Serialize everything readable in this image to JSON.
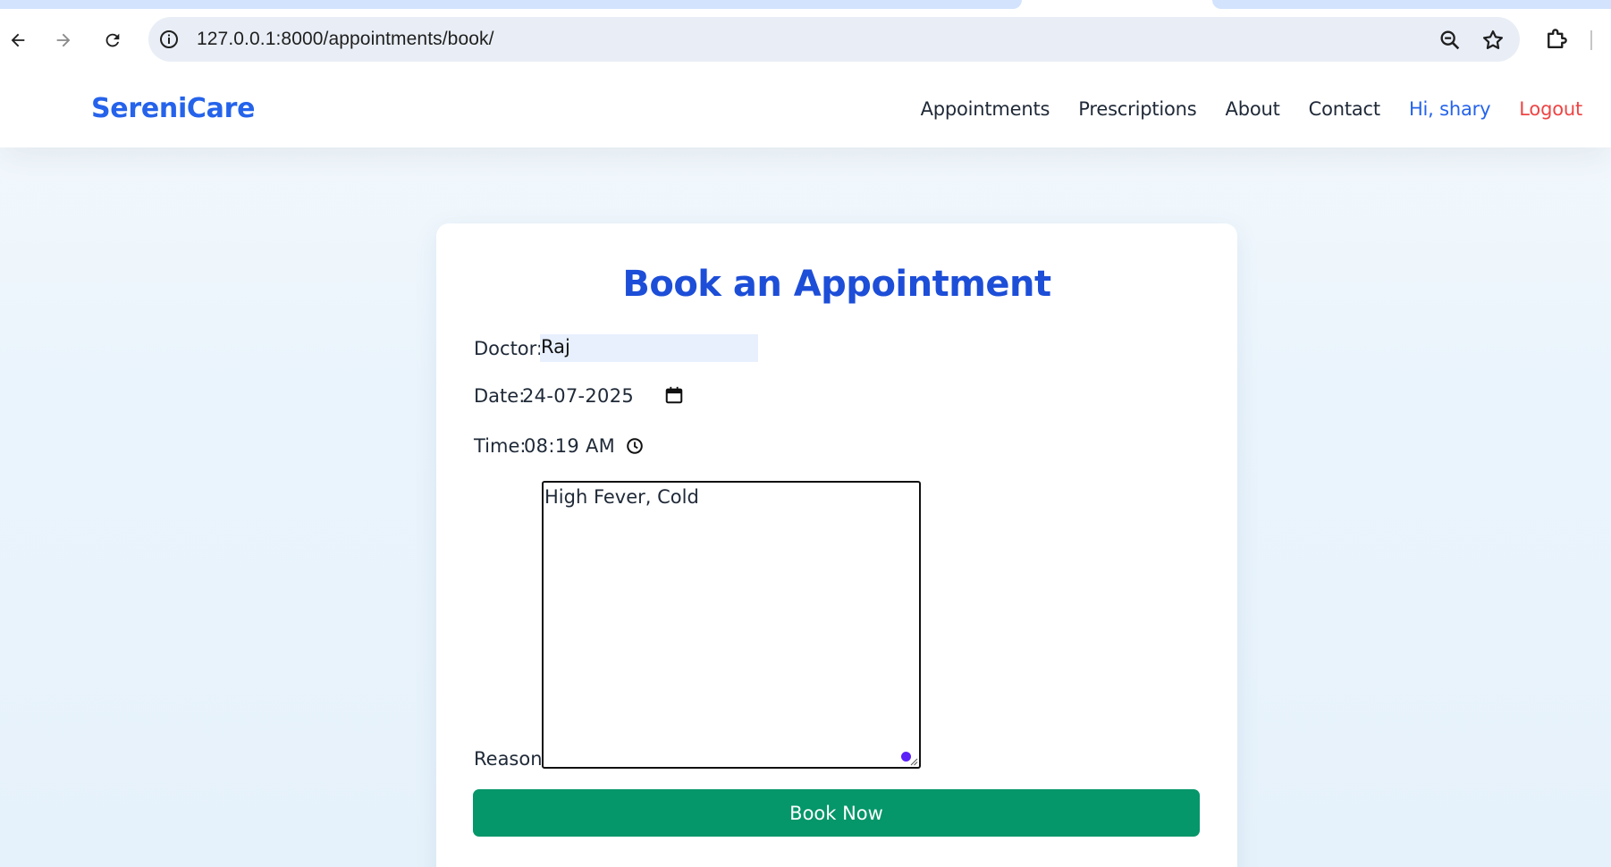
{
  "browser": {
    "url": "127.0.0.1:8000/appointments/book/"
  },
  "navbar": {
    "brand": "SereniCare",
    "links": [
      "Appointments",
      "Prescriptions",
      "About",
      "Contact"
    ],
    "user_greeting": "Hi, shary",
    "logout": "Logout"
  },
  "form": {
    "title": "Book an Appointment",
    "doctor_label": "Doctor:",
    "doctor_value": "Raj",
    "date_label": "Date:",
    "date_value": "24-07-2025",
    "time_label": "Time:",
    "time_value": "08:19 AM",
    "reason_label": "Reason:",
    "reason_value": "High Fever, Cold",
    "submit_label": "Book Now"
  },
  "colors": {
    "brand": "#2563eb",
    "title": "#1d4ed8",
    "logout": "#ef4444",
    "submit": "#059669"
  }
}
